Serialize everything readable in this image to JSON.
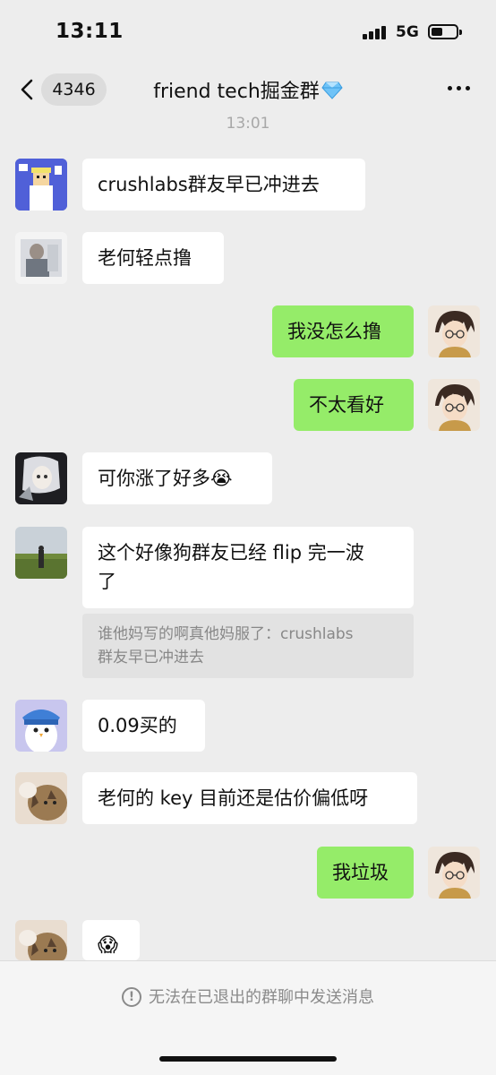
{
  "status_bar": {
    "time": "13:11",
    "network": "5G",
    "signal_icon": "signal-bars-icon",
    "battery_icon": "battery-icon"
  },
  "nav": {
    "back_icon": "chevron-left-icon",
    "unread_count": "4346",
    "title": "friend tech掘金群",
    "title_emoji": "💎",
    "more_icon": "more-dots-icon"
  },
  "timestamp": "13:01",
  "messages": [
    {
      "sender": "other",
      "avatar": "pixel-art-avatar",
      "text": "crushlabs群友早已冲进去"
    },
    {
      "sender": "other",
      "avatar": "photo-avatar",
      "text": "老何轻点撸"
    },
    {
      "sender": "me",
      "avatar": "anime-avatar",
      "text": "我没怎么撸"
    },
    {
      "sender": "me",
      "avatar": "anime-avatar",
      "text": "不太看好"
    },
    {
      "sender": "other",
      "avatar": "illustration-avatar",
      "text": "可你涨了好多😭"
    },
    {
      "sender": "other",
      "avatar": "landscape-avatar",
      "text_line1": "这个好像狗群友已经 flip 完一波",
      "text_line2": "了",
      "quote_line1": "谁他妈写的啊真他妈服了：crushlabs",
      "quote_line2": "群友早已冲进去"
    },
    {
      "sender": "other",
      "avatar": "penguin-avatar",
      "text": "0.09买的"
    },
    {
      "sender": "other",
      "avatar": "cat-avatar",
      "text": "老何的 key 目前还是估价偏低呀"
    },
    {
      "sender": "me",
      "avatar": "anime-avatar",
      "text": "我垃圾"
    },
    {
      "sender": "other",
      "avatar": "cat-avatar",
      "text": "😱"
    }
  ],
  "footer": {
    "notice": "无法在已退出的群聊中发送消息",
    "notice_icon": "info-circle-icon"
  },
  "colors": {
    "background": "#ededed",
    "my_bubble": "#95ec69",
    "other_bubble": "#ffffff"
  }
}
